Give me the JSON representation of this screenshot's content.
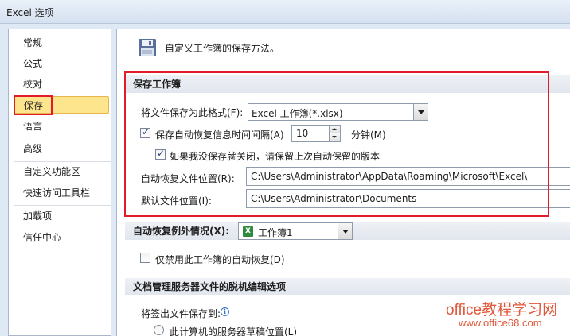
{
  "window": {
    "title": "Excel 选项"
  },
  "sidebar": {
    "items": [
      {
        "label": "常规"
      },
      {
        "label": "公式"
      },
      {
        "label": "校对"
      },
      {
        "label": "保存",
        "selected": true
      },
      {
        "label": "语言"
      },
      {
        "label": "高级"
      },
      {
        "label": "自定义功能区"
      },
      {
        "label": "快速访问工具栏"
      },
      {
        "label": "加载项"
      },
      {
        "label": "信任中心"
      }
    ]
  },
  "header": {
    "icon": "save-disk-icon",
    "text": "自定义工作簿的保存方法。"
  },
  "save_section": {
    "title": "保存工作簿",
    "format_label": "将文件保存为此格式(F):",
    "format_value": "Excel 工作簿(*.xlsx)",
    "autorecover_label": "保存自动恢复信息时间间隔(A)",
    "autorecover_checked": true,
    "autorecover_minutes": "10",
    "minutes_unit": "分钟(M)",
    "keep_last_label": "如果我没保存就关闭，请保留上次自动保留的版本",
    "keep_last_checked": true,
    "autorecover_location_label": "自动恢复文件位置(R):",
    "autorecover_location_value": "C:\\Users\\Administrator\\AppData\\Roaming\\Microsoft\\Excel\\",
    "default_location_label": "默认文件位置(I):",
    "default_location_value": "C:\\Users\\Administrator\\Documents"
  },
  "exceptions": {
    "label": "自动恢复例外情况(X):",
    "workbook_value": "工作簿1",
    "disable_label": "仅禁用此工作簿的自动恢复(D)",
    "disable_checked": false
  },
  "offline_section": {
    "title": "文档管理服务器文件的脱机编辑选项",
    "save_to_label": "将签出文件保存到:",
    "radio_label": "此计算机的服务器草稿位置(L)"
  },
  "watermark": {
    "line1": "office教程学习网",
    "line2": "www.office68.com"
  },
  "colors": {
    "highlight_border": "#e11b2a",
    "selected_bg": "#fde58e",
    "watermark": "#e0573a"
  }
}
